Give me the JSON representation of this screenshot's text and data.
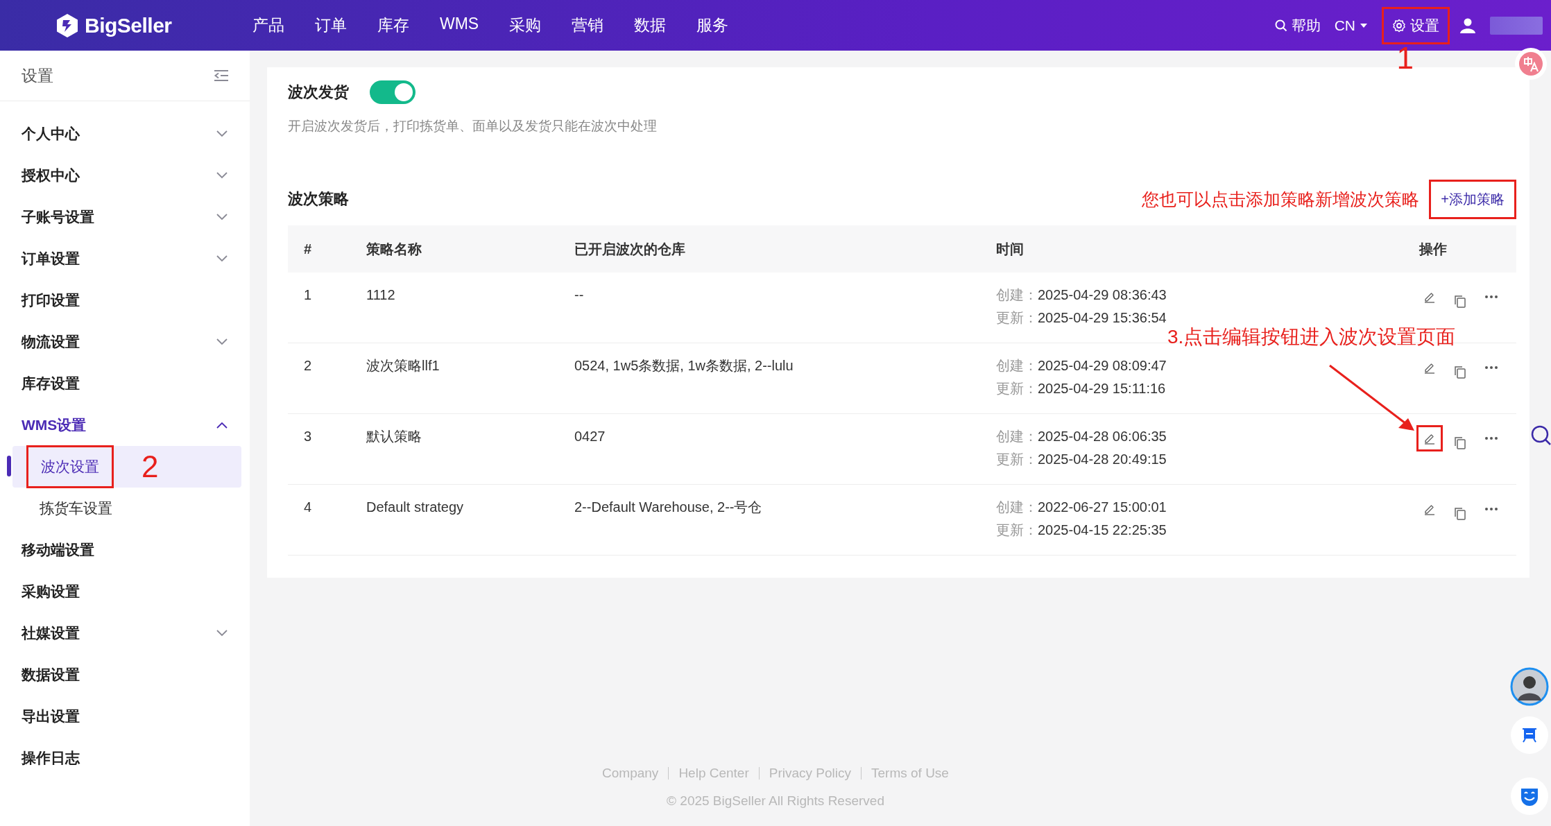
{
  "header": {
    "logo": "BigSeller",
    "nav": [
      {
        "label": "产品",
        "selected": false
      },
      {
        "label": "订单",
        "selected": false
      },
      {
        "label": "库存",
        "selected": false
      },
      {
        "label": "WMS",
        "selected": false
      },
      {
        "label": "采购",
        "selected": false
      },
      {
        "label": "营销",
        "selected": false
      },
      {
        "label": "数据",
        "selected": false
      },
      {
        "label": "服务",
        "selected": false
      }
    ],
    "help": "帮助",
    "language": "CN",
    "settings": {
      "label": "设置",
      "highlighted": true,
      "step": "1"
    }
  },
  "sidebar": {
    "title": "设置",
    "items": [
      {
        "label": "个人中心",
        "expanded": false,
        "selected": false
      },
      {
        "label": "授权中心",
        "expanded": false,
        "selected": false
      },
      {
        "label": "子账号设置",
        "expanded": false,
        "selected": false
      },
      {
        "label": "订单设置",
        "expanded": false,
        "selected": false
      },
      {
        "label": "打印设置",
        "selected": false
      },
      {
        "label": "物流设置",
        "expanded": false,
        "selected": false
      },
      {
        "label": "库存设置",
        "selected": false
      },
      {
        "label": "WMS设置",
        "expanded": true,
        "selected": true,
        "children": [
          {
            "label": "波次设置",
            "selected": true,
            "highlighted": true,
            "step": "2"
          },
          {
            "label": "拣货车设置",
            "selected": false,
            "highlighted": false
          }
        ]
      },
      {
        "label": "移动端设置",
        "selected": false
      },
      {
        "label": "采购设置",
        "selected": false
      },
      {
        "label": "社媒设置",
        "expanded": false,
        "selected": false
      },
      {
        "label": "数据设置",
        "selected": false
      },
      {
        "label": "导出设置",
        "selected": false
      },
      {
        "label": "操作日志",
        "selected": false
      }
    ]
  },
  "wave_shipping": {
    "title": "波次发货",
    "on": true,
    "description": "开启波次发货后，打印拣货单、面单以及发货只能在波次中处理"
  },
  "strategy": {
    "title": "波次策略",
    "hint": "您也可以点击添加策略新增波次策略",
    "add_button": {
      "label": "+添加策略",
      "highlighted": true
    },
    "columns": [
      "#",
      "策略名称",
      "已开启波次的仓库",
      "时间",
      "操作"
    ],
    "rows": [
      {
        "index": "1",
        "name": "1112",
        "warehouses": "--",
        "created_label": "创建：",
        "created": "2025-04-29 08:36:43",
        "updated_label": "更新：",
        "updated": "2025-04-29 15:36:54",
        "edit_highlighted": false
      },
      {
        "index": "2",
        "name": "波次策略llf1",
        "warehouses": "0524, 1w5条数据, 1w条数据, 2--lulu",
        "created_label": "创建：",
        "created": "2025-04-29 08:09:47",
        "updated_label": "更新：",
        "updated": "2025-04-29 15:11:16",
        "edit_highlighted": false
      },
      {
        "index": "3",
        "name": "默认策略",
        "warehouses": "0427",
        "created_label": "创建：",
        "created": "2025-04-28 06:06:35",
        "updated_label": "更新：",
        "updated": "2025-04-28 20:49:15",
        "edit_highlighted": true,
        "hint": "3.点击编辑按钮进入波次设置页面"
      },
      {
        "index": "4",
        "name": "Default strategy",
        "warehouses": "2--Default Warehouse, 2--号仓",
        "created_label": "创建：",
        "created": "2022-06-27 15:00:01",
        "updated_label": "更新：",
        "updated": "2025-04-15 22:25:35",
        "edit_highlighted": false
      }
    ]
  },
  "footer": {
    "links": [
      "Company",
      "Help Center",
      "Privacy Policy",
      "Terms of Use"
    ],
    "copyright": "© 2025 BigSeller All Rights Reserved"
  }
}
